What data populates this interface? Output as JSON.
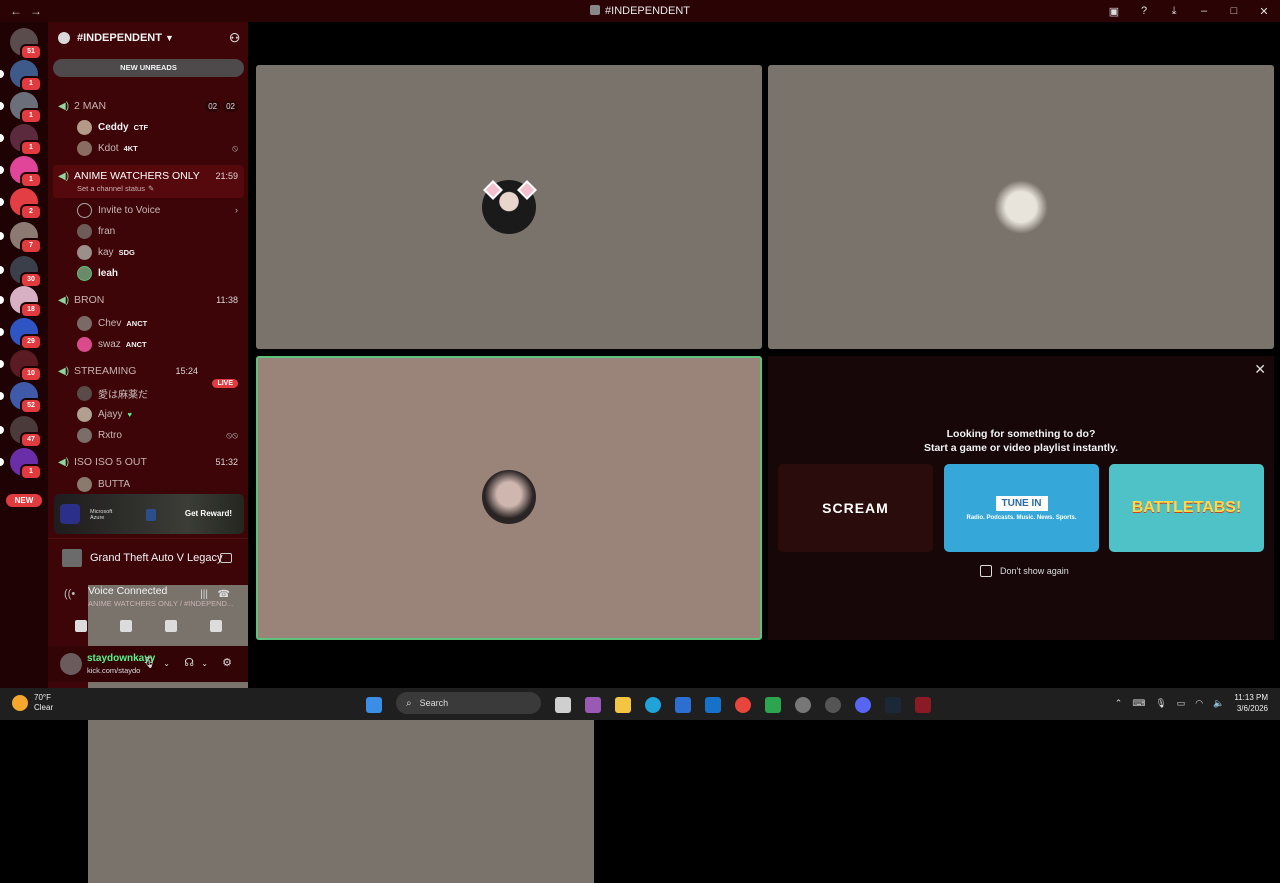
{
  "titlebar": {
    "back": "←",
    "forward": "→",
    "title": "#INDEPENDENT"
  },
  "servers": {
    "badges": [
      "51",
      "1",
      "1",
      "1",
      "1",
      "2",
      "7",
      "30",
      "18",
      "29",
      "10",
      "52",
      "47",
      "1"
    ],
    "new_label": "NEW"
  },
  "sidebar": {
    "server_name": "#INDEPENDENT",
    "new_unreads": "NEW UNREADS",
    "channels": [
      {
        "name": "2 MAN",
        "count_a": "02",
        "count_b": "02",
        "users": [
          {
            "name": "Ceddy",
            "tag": "CTF"
          },
          {
            "name": "Kdot",
            "tag": "4KT"
          }
        ]
      },
      {
        "name": "ANIME WATCHERS ONLY",
        "time": "21:59",
        "status": "Set a channel status",
        "invite": "Invite to Voice",
        "users": [
          {
            "name": "fran",
            "tag": ""
          },
          {
            "name": "kay",
            "tag": "SDG"
          },
          {
            "name": "leah",
            "tag": ""
          }
        ]
      },
      {
        "name": "BRON",
        "time": "11:38",
        "users": [
          {
            "name": "Chev",
            "tag": "ANCT"
          },
          {
            "name": "swaz",
            "tag": "ANCT"
          }
        ]
      },
      {
        "name": "STREAMING",
        "time": "15:24",
        "live": "LIVE",
        "users": [
          {
            "name": "愛は麻薬だ",
            "tag": ""
          },
          {
            "name": "Ajayy",
            "tag": ""
          },
          {
            "name": "Rxtro",
            "tag": ""
          }
        ]
      },
      {
        "name": "ISO ISO 5 OUT",
        "time": "51:32",
        "users": [
          {
            "name": "BUTTA",
            "tag": ""
          }
        ]
      }
    ]
  },
  "promo": {
    "brand_line1": "Microsoft",
    "brand_line2": "Azure",
    "cta": "Get Reward!"
  },
  "activity": {
    "game": "Grand Theft Auto V Legacy"
  },
  "voice": {
    "status": "Voice Connected",
    "channel": "ANIME WATCHERS ONLY / #INDEPEND..."
  },
  "user": {
    "name": "staydownkayy",
    "sub": "kick.com/staydo"
  },
  "suggestions": {
    "line1": "Looking for something to do?",
    "line2": "Start a game or video playlist instantly.",
    "cards": [
      "SCREAM",
      "TUNE IN",
      "BATTLETABS!"
    ],
    "tunein_sub": "Radio. Podcasts. Music. News. Sports.",
    "dont_show": "Don't show again"
  },
  "taskbar": {
    "temp": "70°F",
    "weather": "Clear",
    "search": "Search",
    "time": "11:13 PM",
    "date": "3/6/2026"
  },
  "colors": {
    "accent_green": "#5fc27a",
    "sidebar_bg": "#3d0507",
    "badge_red": "#e03b3f"
  }
}
